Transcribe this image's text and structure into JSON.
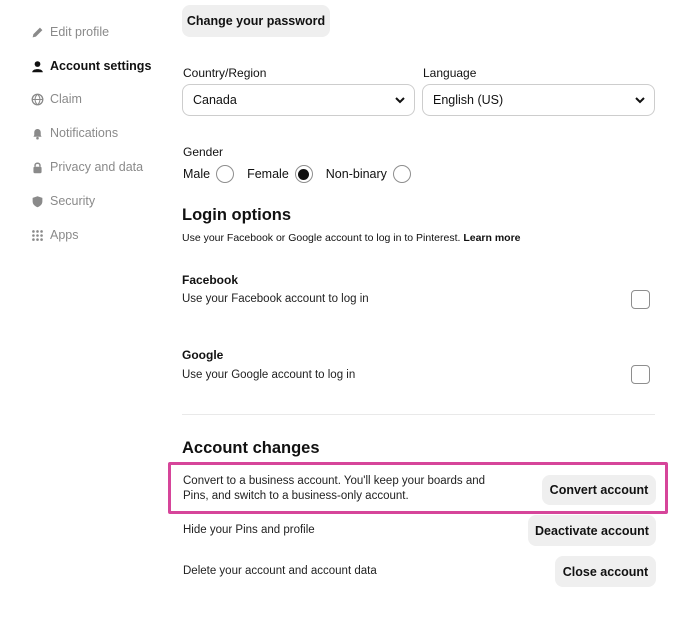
{
  "sidebar": {
    "items": [
      {
        "label": "Edit profile",
        "icon": "pencil-icon"
      },
      {
        "label": "Account settings",
        "icon": "person-icon",
        "active": true
      },
      {
        "label": "Claim",
        "icon": "globe-icon"
      },
      {
        "label": "Notifications",
        "icon": "bell-icon"
      },
      {
        "label": "Privacy and data",
        "icon": "lock-icon"
      },
      {
        "label": "Security",
        "icon": "shield-icon"
      },
      {
        "label": "Apps",
        "icon": "grid-icon"
      }
    ]
  },
  "main": {
    "change_password_label": "Change your password",
    "country": {
      "label": "Country/Region",
      "value": "Canada"
    },
    "language": {
      "label": "Language",
      "value": "English (US)"
    },
    "gender": {
      "label": "Gender",
      "options": [
        {
          "label": "Male",
          "checked": false
        },
        {
          "label": "Female",
          "checked": true
        },
        {
          "label": "Non-binary",
          "checked": false
        }
      ]
    },
    "login_options": {
      "title": "Login options",
      "description": "Use your Facebook or Google account to log in to Pinterest.",
      "learn_more": "Learn more",
      "facebook": {
        "title": "Facebook",
        "text": "Use your Facebook account to log in",
        "checked": false
      },
      "google": {
        "title": "Google",
        "text": "Use your Google account to log in",
        "checked": false
      }
    },
    "account_changes": {
      "title": "Account changes",
      "convert": {
        "text": "Convert to a business account. You'll keep your boards and Pins, and switch to a business-only account.",
        "button": "Convert account"
      },
      "deactivate": {
        "text": "Hide your Pins and profile",
        "button": "Deactivate account"
      },
      "close": {
        "text": "Delete your account and account data",
        "button": "Close account"
      }
    }
  },
  "colors": {
    "highlight": "#d6459a",
    "button_bg": "#efefef",
    "inactive_text": "#8a8a8a"
  }
}
